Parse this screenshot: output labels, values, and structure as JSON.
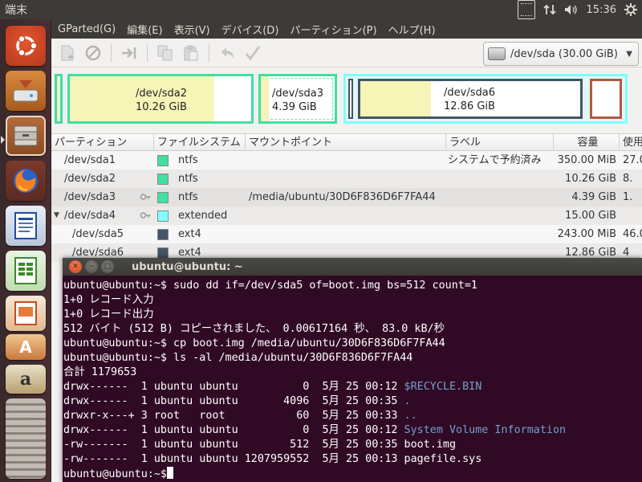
{
  "top_panel": {
    "title": "端末",
    "clock": "15:36",
    "icons": [
      "keyboard-icon",
      "network-icon",
      "volume-icon",
      "settings-gear-icon"
    ]
  },
  "launcher": {
    "items": [
      "ubuntu-logo-icon",
      "disk-installer-icon",
      "file-manager-icon",
      "firefox-icon",
      "writer-icon",
      "calc-icon",
      "impress-icon",
      "software-center-icon",
      "amazon-icon"
    ]
  },
  "gparted": {
    "menu": [
      "GParted(G)",
      "編集(E)",
      "表示(V)",
      "デバイス(D)",
      "パーティション(P)",
      "ヘルプ(H)"
    ],
    "device_select": "/dev/sda  (30.00 GiB)",
    "disk_map": [
      {
        "name": "/dev/sda2",
        "size": "10.26 GiB"
      },
      {
        "name": "/dev/sda3",
        "size": "4.39 GiB"
      },
      {
        "name": "/dev/sda6",
        "size": "12.86 GiB"
      }
    ],
    "columns": [
      "パーティション",
      "ファイルシステム",
      "マウントポイント",
      "ラベル",
      "容量",
      "使用"
    ],
    "rows": [
      {
        "partition": "/dev/sda1",
        "fs": "ntfs",
        "fs_color": "#40e0a0",
        "mount": "",
        "label": "システムで予約済み",
        "size": "350.00 MiB",
        "used": "27.0"
      },
      {
        "partition": "/dev/sda2",
        "fs": "ntfs",
        "fs_color": "#40e0a0",
        "mount": "",
        "label": "",
        "size": "10.26 GiB",
        "used": "8."
      },
      {
        "partition": "/dev/sda3",
        "fs": "ntfs",
        "fs_color": "#40e0a0",
        "mount": "/media/ubuntu/30D6F836D6F7FA44",
        "label": "",
        "size": "4.39 GiB",
        "used": "1."
      },
      {
        "partition": "/dev/sda4",
        "fs": "extended",
        "fs_color": "#7fffff",
        "mount": "",
        "label": "",
        "size": "15.00 GiB",
        "used": ""
      },
      {
        "partition": "/dev/sda5",
        "fs": "ext4",
        "fs_color": "#445566",
        "mount": "",
        "label": "",
        "size": "243.00 MiB",
        "used": "46.0"
      },
      {
        "partition": "/dev/sda6",
        "fs": "ext4",
        "fs_color": "#445566",
        "mount": "",
        "label": "",
        "size": "12.86 GiB",
        "used": "4"
      }
    ]
  },
  "terminal": {
    "title": "ubuntu@ubuntu: ~",
    "lines": [
      {
        "text": "ubuntu@ubuntu:~$ sudo dd if=/dev/sda5 of=boot.img bs=512 count=1"
      },
      {
        "text": "1+0 レコード入力"
      },
      {
        "text": "1+0 レコード出力"
      },
      {
        "text": "512 バイト (512 B) コピーされました、 0.00617164 秒、 83.0 kB/秒"
      },
      {
        "text": "ubuntu@ubuntu:~$ cp boot.img /media/ubuntu/30D6F836D6F7FA44"
      },
      {
        "text": "ubuntu@ubuntu:~$ ls -al /media/ubuntu/30D6F836D6F7FA44"
      },
      {
        "text": "合計 1179653"
      }
    ],
    "listing": [
      {
        "perm": "drwx------",
        "n": "1",
        "user": "ubuntu",
        "group": "ubuntu",
        "size": "0",
        "month": "5月",
        "day": "25",
        "time": "00:12",
        "name": "$RECYCLE.BIN",
        "blue": true
      },
      {
        "perm": "drwx------",
        "n": "1",
        "user": "ubuntu",
        "group": "ubuntu",
        "size": "4096",
        "month": "5月",
        "day": "25",
        "time": "00:35",
        "name": ".",
        "blue": true
      },
      {
        "perm": "drwxr-x---+",
        "n": "3",
        "user": "root",
        "group": "root",
        "size": "60",
        "month": "5月",
        "day": "25",
        "time": "00:33",
        "name": "..",
        "blue": true
      },
      {
        "perm": "drwx------",
        "n": "1",
        "user": "ubuntu",
        "group": "ubuntu",
        "size": "0",
        "month": "5月",
        "day": "25",
        "time": "00:12",
        "name": "System Volume Information",
        "blue": true
      },
      {
        "perm": "-rw-------",
        "n": "1",
        "user": "ubuntu",
        "group": "ubuntu",
        "size": "512",
        "month": "5月",
        "day": "25",
        "time": "00:35",
        "name": "boot.img",
        "blue": false
      },
      {
        "perm": "-rw-------",
        "n": "1",
        "user": "ubuntu",
        "group": "ubuntu",
        "size": "1207959552",
        "month": "5月",
        "day": "25",
        "time": "00:13",
        "name": "pagefile.sys",
        "blue": false
      }
    ],
    "prompt": "ubuntu@ubuntu:~$"
  }
}
